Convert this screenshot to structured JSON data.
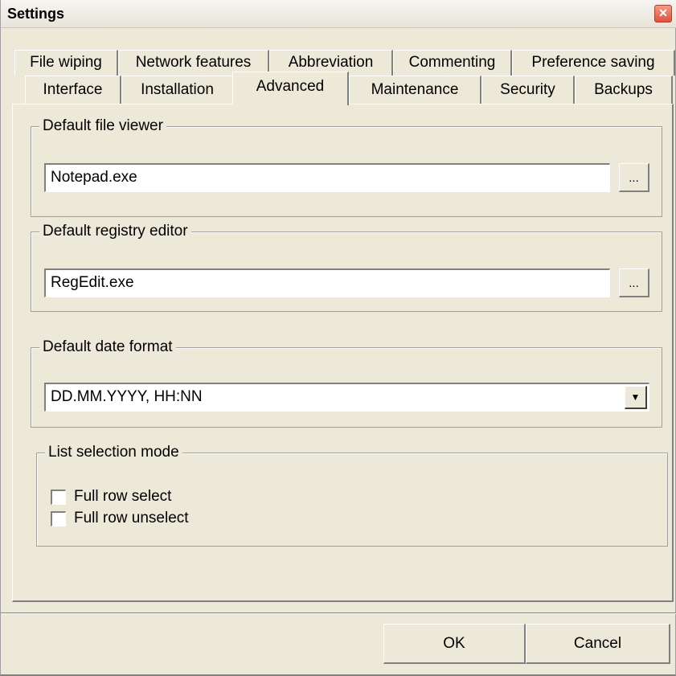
{
  "window": {
    "title": "Settings"
  },
  "tabs": {
    "row1": [
      "File wiping",
      "Network features",
      "Abbreviation",
      "Commenting",
      "Preference saving"
    ],
    "row2": [
      "Interface",
      "Installation",
      "Advanced",
      "Maintenance",
      "Security",
      "Backups"
    ],
    "active": "Advanced"
  },
  "file_viewer": {
    "legend": "Default file viewer",
    "value": "Notepad.exe",
    "browse_label": "..."
  },
  "registry_editor": {
    "legend": "Default registry editor",
    "value": "RegEdit.exe",
    "browse_label": "..."
  },
  "date_format": {
    "legend": "Default date format",
    "selected": "DD.MM.YYYY, HH:NN"
  },
  "list_selection": {
    "legend": "List selection mode",
    "options": [
      {
        "label": "Full row select",
        "checked": false
      },
      {
        "label": "Full row unselect",
        "checked": false
      }
    ]
  },
  "buttons": {
    "ok": "OK",
    "cancel": "Cancel"
  },
  "colors": {
    "face": "#ece9d8",
    "close_button": "#e0523a",
    "shadow": "#808080"
  }
}
